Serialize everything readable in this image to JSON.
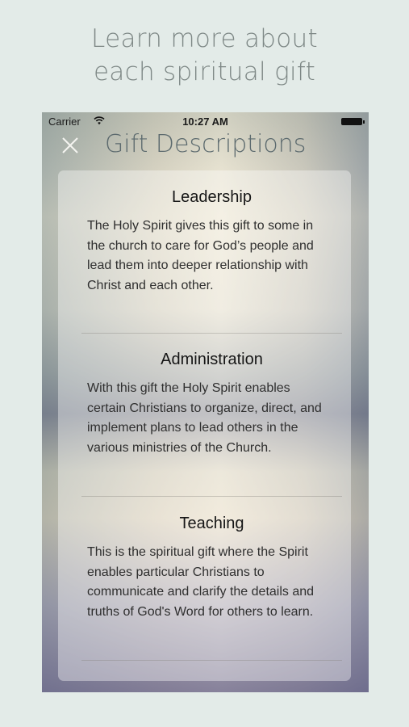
{
  "promo": {
    "line1": "Learn more about",
    "line2": "each spiritual gift"
  },
  "status_bar": {
    "carrier": "Carrier",
    "time": "10:27 AM"
  },
  "nav": {
    "title": "Gift Descriptions",
    "close_icon": "close-icon"
  },
  "gifts": [
    {
      "title": "Leadership",
      "description": "The Holy Spirit gives this gift to some in the church to care for God’s people and lead them into deeper relationship with Christ and each other."
    },
    {
      "title": "Administration",
      "description": "With this gift the Holy Spirit enables certain Christians to organize, direct, and implement plans to lead others in the various ministries of the Church."
    },
    {
      "title": "Teaching",
      "description": "This is the spiritual gift where the Spirit enables particular Christians to communicate and clarify the details and truths of God's Word for others to learn."
    }
  ],
  "colors": {
    "background": "#e3ebe8",
    "caption": "#7e8886",
    "nav_title": "#5c6a6e"
  }
}
